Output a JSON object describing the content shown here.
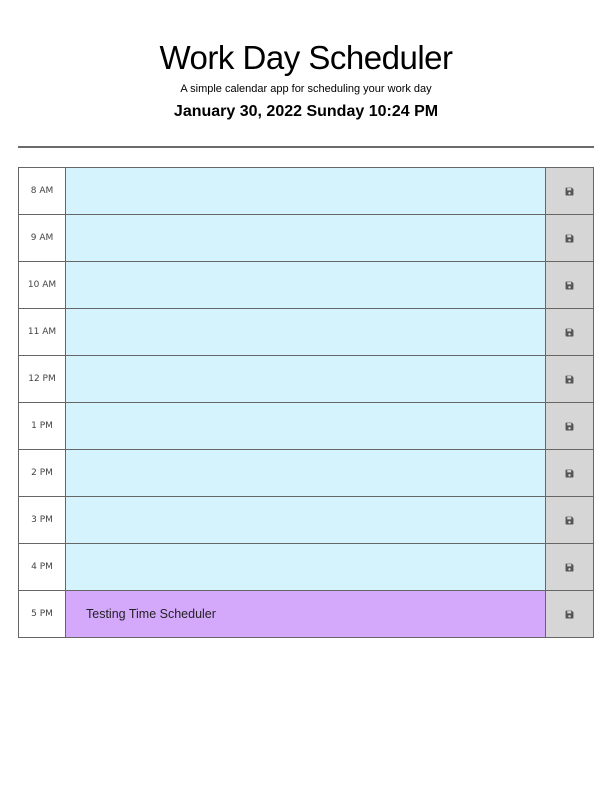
{
  "header": {
    "title": "Work Day Scheduler",
    "subtitle": "A simple calendar app for scheduling your work day",
    "current_datetime": "January 30, 2022 Sunday 10:24 PM"
  },
  "colors": {
    "future": "#d5f3fd",
    "present": "#d4a9fc",
    "save_button": "#d6d6d6"
  },
  "time_blocks": [
    {
      "hour": "8 AM",
      "text": "",
      "state": "future",
      "save_icon": "floppy-disk-icon"
    },
    {
      "hour": "9 AM",
      "text": "",
      "state": "future",
      "save_icon": "floppy-disk-icon"
    },
    {
      "hour": "10 AM",
      "text": "",
      "state": "future",
      "save_icon": "floppy-disk-icon"
    },
    {
      "hour": "11 AM",
      "text": "",
      "state": "future",
      "save_icon": "floppy-disk-icon"
    },
    {
      "hour": "12 PM",
      "text": "",
      "state": "future",
      "save_icon": "floppy-disk-icon"
    },
    {
      "hour": "1 PM",
      "text": "",
      "state": "future",
      "save_icon": "floppy-disk-icon"
    },
    {
      "hour": "2 PM",
      "text": "",
      "state": "future",
      "save_icon": "floppy-disk-icon"
    },
    {
      "hour": "3 PM",
      "text": "",
      "state": "future",
      "save_icon": "floppy-disk-icon"
    },
    {
      "hour": "4 PM",
      "text": "",
      "state": "future",
      "save_icon": "floppy-disk-icon"
    },
    {
      "hour": "5 PM",
      "text": "Testing Time Scheduler",
      "state": "present",
      "save_icon": "floppy-disk-icon"
    }
  ]
}
